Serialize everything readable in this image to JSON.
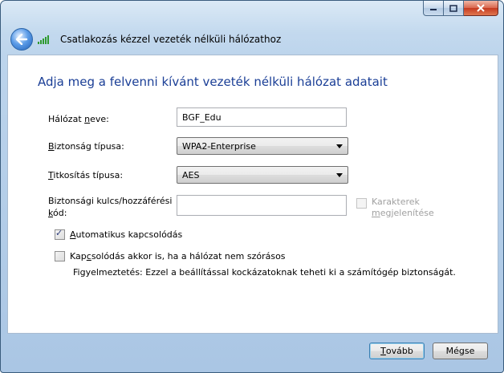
{
  "window": {
    "title": "Csatlakozás kézzel vezeték nélküli hálózathoz",
    "heading": "Adja meg a felvenni kívánt vezeték nélküli hálózat adatait"
  },
  "form": {
    "network_name": {
      "label_pre": "Hálózat ",
      "label_key": "n",
      "label_post": "eve:",
      "value": "BGF_Edu"
    },
    "security_type": {
      "label_key": "B",
      "label_post": "iztonság típusa:",
      "value": "WPA2-Enterprise"
    },
    "encryption_type": {
      "label_key": "T",
      "label_post": "itkosítás típusa:",
      "value": "AES"
    },
    "security_key": {
      "label_line1": "Biztonsági kulcs/hozzáférési",
      "label_key": "k",
      "label_line2_post": "ód:",
      "value": ""
    },
    "show_characters": {
      "label_line1": "Karakterek",
      "label_key": "m",
      "label_line2_post": "egjelenítése",
      "checked": false,
      "enabled": false
    },
    "auto_connect": {
      "label_key": "A",
      "label_post": "utomatikus kapcsolódás",
      "checked": true
    },
    "connect_not_broadcast": {
      "label_pre": "Kap",
      "label_key": "c",
      "label_post": "solódás akkor is, ha a hálózat nem szórásos",
      "checked": false
    },
    "warning": "Figyelmeztetés: Ezzel a beállítással kockázatoknak teheti ki a számítógép biztonságát."
  },
  "buttons": {
    "next_key": "T",
    "next_post": "ovább",
    "cancel": "Mégse"
  },
  "colors": {
    "heading": "#1a3e96",
    "close_button": "#c53a20",
    "accent": "#3c7fb1"
  },
  "icons": {
    "back": "back-arrow-icon",
    "network": "wireless-signal-icon",
    "minimize": "minimize-icon",
    "maximize": "maximize-icon",
    "close": "close-icon"
  }
}
